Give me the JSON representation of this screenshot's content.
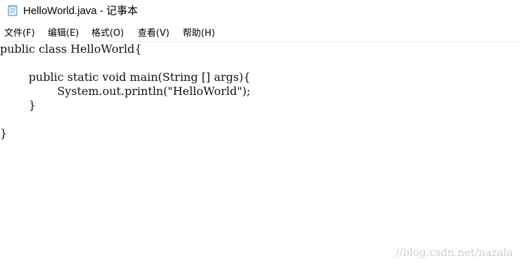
{
  "window": {
    "title": "HelloWorld.java - 记事本",
    "icon": "notepad-icon"
  },
  "menu": {
    "items": [
      {
        "label": "文件(F)"
      },
      {
        "label": "编辑(E)"
      },
      {
        "label": "格式(O)"
      },
      {
        "label": "查看(V)"
      },
      {
        "label": "帮助(H)"
      }
    ]
  },
  "editor": {
    "lines": [
      "public class HelloWorld{",
      "",
      "        public static void main(String [] args){",
      "                System.out.println(\"HelloWorld\");",
      "        }",
      "",
      "}"
    ]
  },
  "watermark": {
    "text": "//blog.csdn.net/nazala"
  }
}
